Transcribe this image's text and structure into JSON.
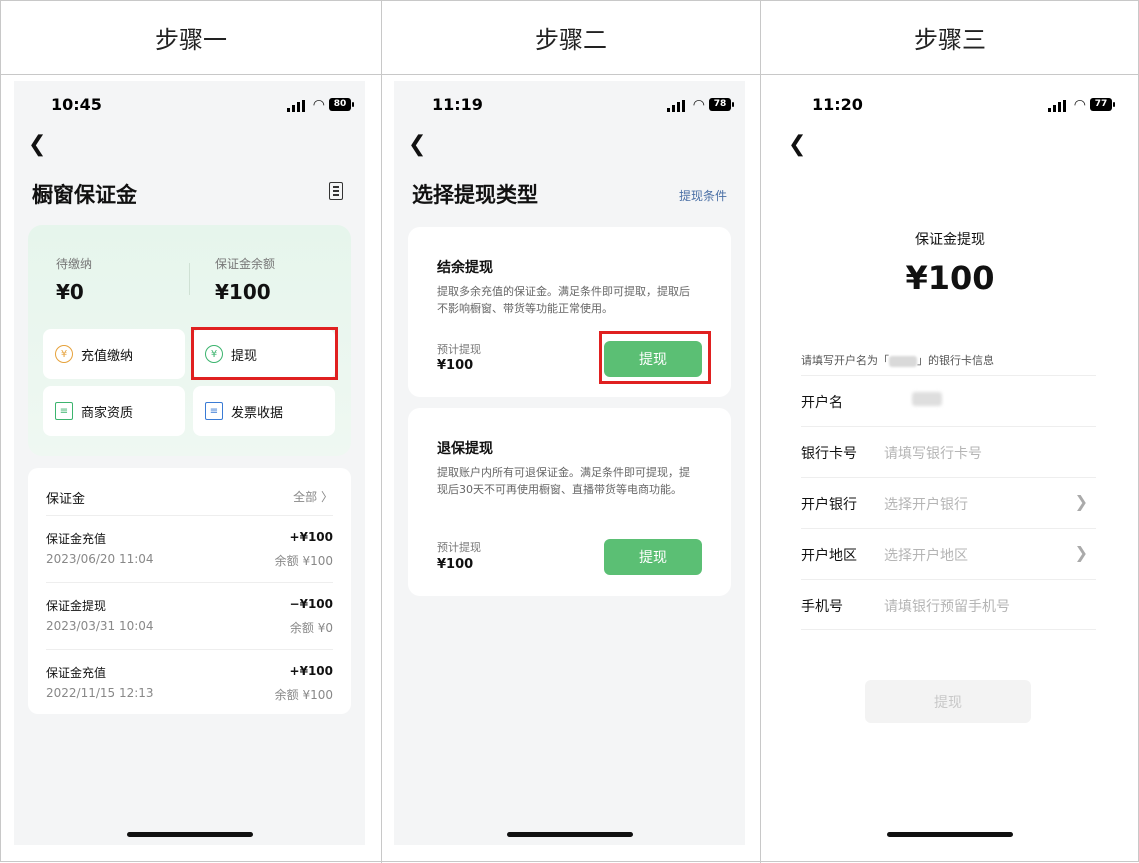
{
  "steps": [
    "步骤一",
    "步骤二",
    "步骤三"
  ],
  "screen1": {
    "time": "10:45",
    "battery": "80",
    "title": "橱窗保证金",
    "pending_label": "待缴纳",
    "pending_value": "¥0",
    "balance_label": "保证金余额",
    "balance_value": "¥100",
    "tiles": [
      "充值缴纳",
      "提现",
      "商家资质",
      "发票收据"
    ],
    "list_title": "保证金",
    "list_all": "全部 〉",
    "records": [
      {
        "title": "保证金充值",
        "date": "2023/06/20 11:04",
        "amount": "+¥100",
        "remain": "余额 ¥100"
      },
      {
        "title": "保证金提现",
        "date": "2023/03/31 10:04",
        "amount": "−¥100",
        "remain": "余额 ¥0"
      },
      {
        "title": "保证金充值",
        "date": "2022/11/15 12:13",
        "amount": "+¥100",
        "remain": "余额 ¥100"
      }
    ]
  },
  "screen2": {
    "time": "11:19",
    "battery": "78",
    "title": "选择提现类型",
    "conditions_link": "提现条件",
    "card1": {
      "heading": "结余提现",
      "desc": "提取多余充值的保证金。满足条件即可提取，提取后不影响橱窗、带货等功能正常使用。",
      "est_label": "预计提现",
      "est_value": "¥100",
      "button": "提现"
    },
    "card2": {
      "heading": "退保提现",
      "desc": "提取账户内所有可退保证金。满足条件即可提现，提现后30天不可再使用橱窗、直播带货等电商功能。",
      "est_label": "预计提现",
      "est_value": "¥100",
      "button": "提现"
    }
  },
  "screen3": {
    "time": "11:20",
    "battery": "77",
    "title": "保证金提现",
    "amount": "¥100",
    "hint_prefix": "请填写开户名为「",
    "hint_suffix": "」的银行卡信息",
    "fields": [
      {
        "label": "开户名",
        "value": ""
      },
      {
        "label": "银行卡号",
        "value": "请填写银行卡号"
      },
      {
        "label": "开户银行",
        "value": "选择开户银行"
      },
      {
        "label": "开户地区",
        "value": "选择开户地区"
      },
      {
        "label": "手机号",
        "value": "请填银行预留手机号"
      }
    ],
    "submit": "提现"
  },
  "icons": {
    "back": "chevron-left-icon",
    "signal": "signal-icon",
    "wifi": "wifi-icon",
    "battery": "battery-icon",
    "doc": "document-icon",
    "chevron": "chevron-right-icon"
  },
  "colors": {
    "accent_green": "#5bbf74",
    "highlight_red": "#e02020",
    "link_blue": "#4a6fa5"
  }
}
